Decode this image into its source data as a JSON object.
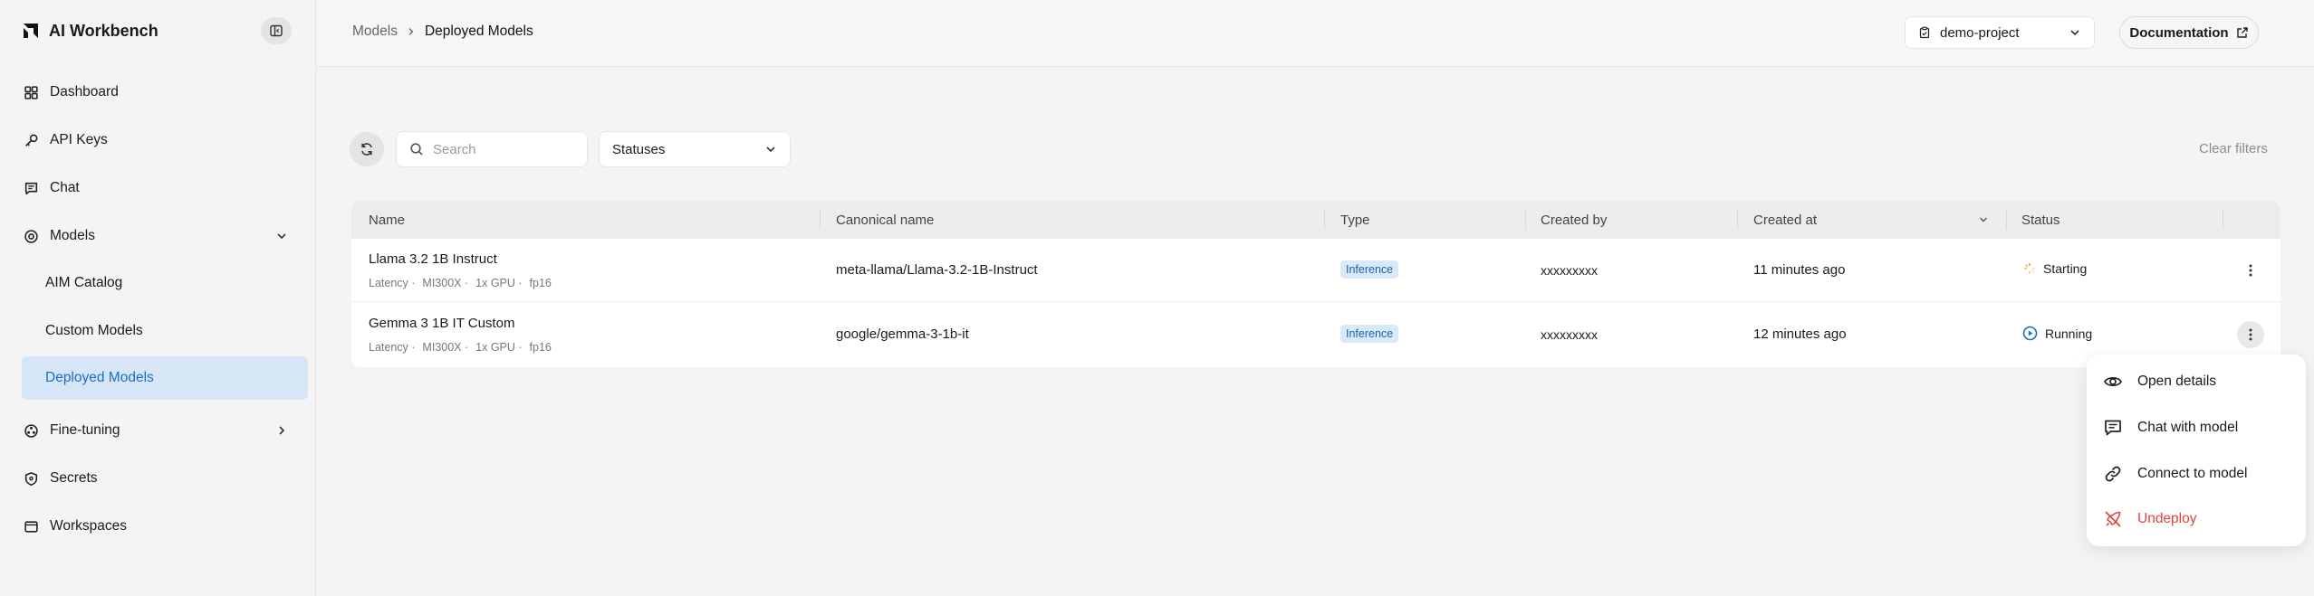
{
  "app": {
    "title": "AI Workbench"
  },
  "sidebar": {
    "items": [
      {
        "label": "Dashboard"
      },
      {
        "label": "API Keys"
      },
      {
        "label": "Chat"
      },
      {
        "label": "Models"
      },
      {
        "label": "Fine-tuning"
      },
      {
        "label": "Secrets"
      },
      {
        "label": "Workspaces"
      }
    ],
    "models_subitems": [
      {
        "label": "AIM Catalog"
      },
      {
        "label": "Custom Models"
      },
      {
        "label": "Deployed Models"
      }
    ]
  },
  "breadcrumb": {
    "parent": "Models",
    "current": "Deployed Models"
  },
  "header": {
    "project": "demo-project",
    "documentation_label": "Documentation"
  },
  "filters": {
    "search_placeholder": "Search",
    "status_value": "Statuses",
    "clear_label": "Clear filters"
  },
  "table": {
    "columns": [
      "Name",
      "Canonical name",
      "Type",
      "Created by",
      "Created at",
      "Status"
    ],
    "rows": [
      {
        "name": "Llama 3.2 1B Instruct",
        "meta": [
          "Latency ·",
          "MI300X ·",
          "1x GPU ·",
          "fp16"
        ],
        "canonical": "meta-llama/Llama-3.2-1B-Instruct",
        "type": "Inference",
        "created_by": "xxxxxxxxx",
        "created_at": "11 minutes ago",
        "status": "Starting"
      },
      {
        "name": "Gemma 3 1B IT Custom",
        "meta": [
          "Latency ·",
          "MI300X ·",
          "1x GPU ·",
          "fp16"
        ],
        "canonical": "google/gemma-3-1b-it",
        "type": "Inference",
        "created_by": "xxxxxxxxx",
        "created_at": "12 minutes ago",
        "status": "Running"
      }
    ]
  },
  "context_menu": {
    "items": [
      {
        "label": "Open details",
        "icon": "eye-icon"
      },
      {
        "label": "Chat with model",
        "icon": "chat-icon"
      },
      {
        "label": "Connect to model",
        "icon": "link-icon"
      },
      {
        "label": "Undeploy",
        "icon": "rocket-off-icon"
      }
    ]
  },
  "colors": {
    "accent": "#1a6fc2",
    "active_bg": "#d7e6f6",
    "danger": "#e0453a",
    "starting": "#f0a020"
  }
}
